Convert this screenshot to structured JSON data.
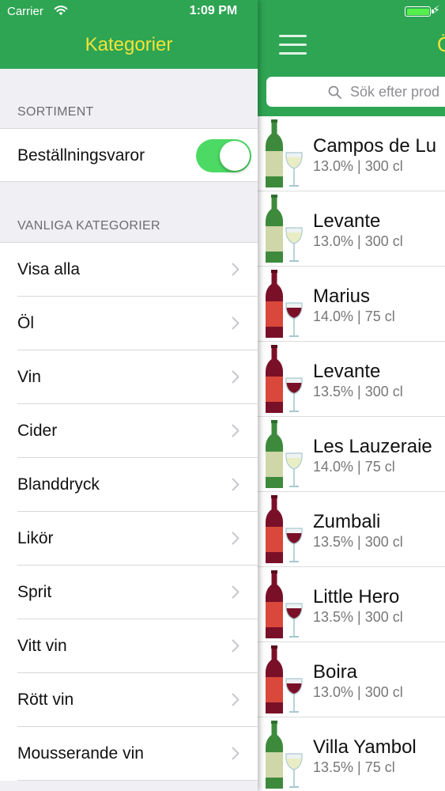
{
  "status_bar": {
    "carrier": "Carrier",
    "time": "1:09 PM"
  },
  "drawer": {
    "title": "Kategorier",
    "sortiment_header": "SORTIMENT",
    "toggle": {
      "label": "Beställningsvaror",
      "on": true
    },
    "categories_header": "VANLIGA KATEGORIER",
    "categories": [
      {
        "label": "Visa alla"
      },
      {
        "label": "Öl"
      },
      {
        "label": "Vin"
      },
      {
        "label": "Cider"
      },
      {
        "label": "Blanddryck"
      },
      {
        "label": "Likör"
      },
      {
        "label": "Sprit"
      },
      {
        "label": "Vitt vin"
      },
      {
        "label": "Rött vin"
      },
      {
        "label": "Mousserande vin"
      }
    ]
  },
  "main": {
    "title_partial": "Ö",
    "search": {
      "placeholder": "Sök efter prod"
    },
    "products": [
      {
        "name": "Campos de Lu",
        "meta": "13.0% | 300 cl",
        "type": "white"
      },
      {
        "name": "Levante",
        "meta": "13.0% | 300 cl",
        "type": "white"
      },
      {
        "name": "Marius",
        "meta": "14.0% | 75 cl",
        "type": "red"
      },
      {
        "name": "Levante",
        "meta": "13.5% | 300 cl",
        "type": "red"
      },
      {
        "name": "Les Lauzeraie",
        "meta": "14.0% | 75 cl",
        "type": "white"
      },
      {
        "name": "Zumbali",
        "meta": "13.5% | 300 cl",
        "type": "red"
      },
      {
        "name": "Little Hero",
        "meta": "13.5% | 300 cl",
        "type": "red"
      },
      {
        "name": "Boira",
        "meta": "13.0% | 300 cl",
        "type": "red"
      },
      {
        "name": "Villa Yambol",
        "meta": "13.5% | 75 cl",
        "type": "white"
      }
    ]
  },
  "colors": {
    "brand_green": "#2ea553",
    "title_yellow": "#f2e33a",
    "switch_on": "#4cd964",
    "white_wine_bottle": "#3d8a3c",
    "red_wine_bottle": "#7a1028"
  },
  "icons": {
    "wifi": "wifi-icon",
    "battery": "battery-icon",
    "charging": "charging-bolt-icon",
    "menu": "hamburger-menu-icon",
    "search": "search-icon",
    "chevron": "chevron-right-icon",
    "white_wine": "white-wine-bottle-glass-icon",
    "red_wine": "red-wine-bottle-glass-icon"
  }
}
